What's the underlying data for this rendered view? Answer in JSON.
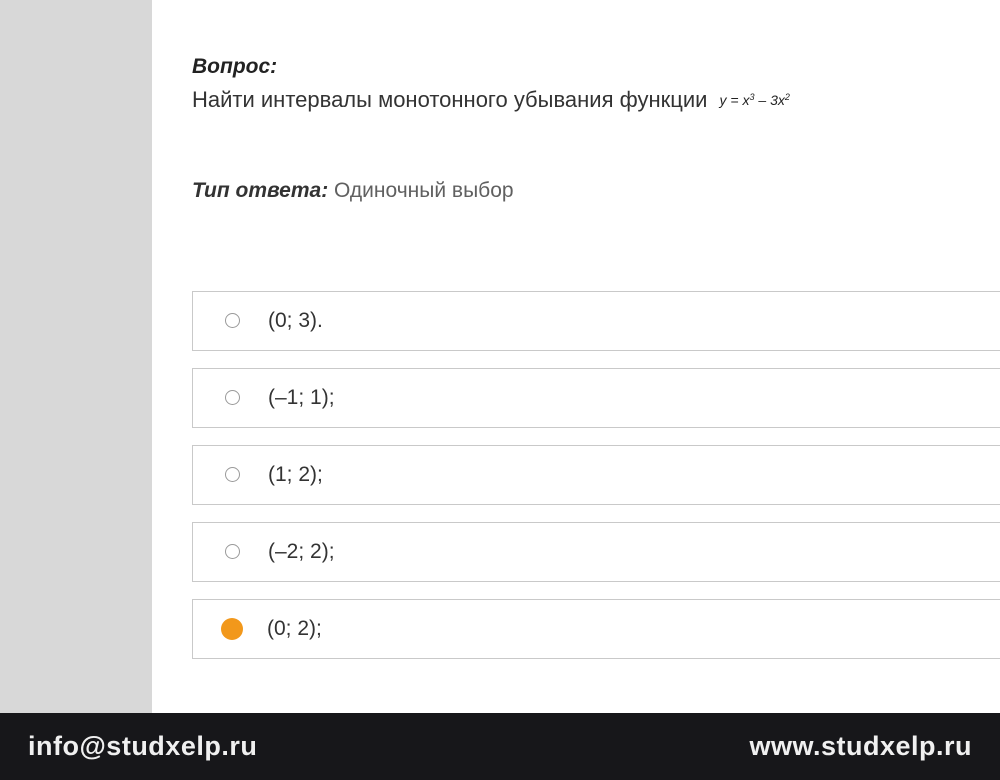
{
  "question": {
    "label": "Вопрос:",
    "text": "Найти интервалы монотонного убывания функции",
    "formula_html": "y = x<sup>3</sup> – 3x<sup>2</sup>"
  },
  "answer_type": {
    "label": "Тип ответа:",
    "value": "Одиночный выбор"
  },
  "options": [
    {
      "text": "(0; 3).",
      "selected": false
    },
    {
      "text": "(–1; 1);",
      "selected": false
    },
    {
      "text": "(1; 2);",
      "selected": false
    },
    {
      "text": "(–2; 2);",
      "selected": false
    },
    {
      "text": "(0; 2);",
      "selected": true
    }
  ],
  "footer": {
    "email": "info@studxelp.ru",
    "website": "www.studxelp.ru"
  }
}
